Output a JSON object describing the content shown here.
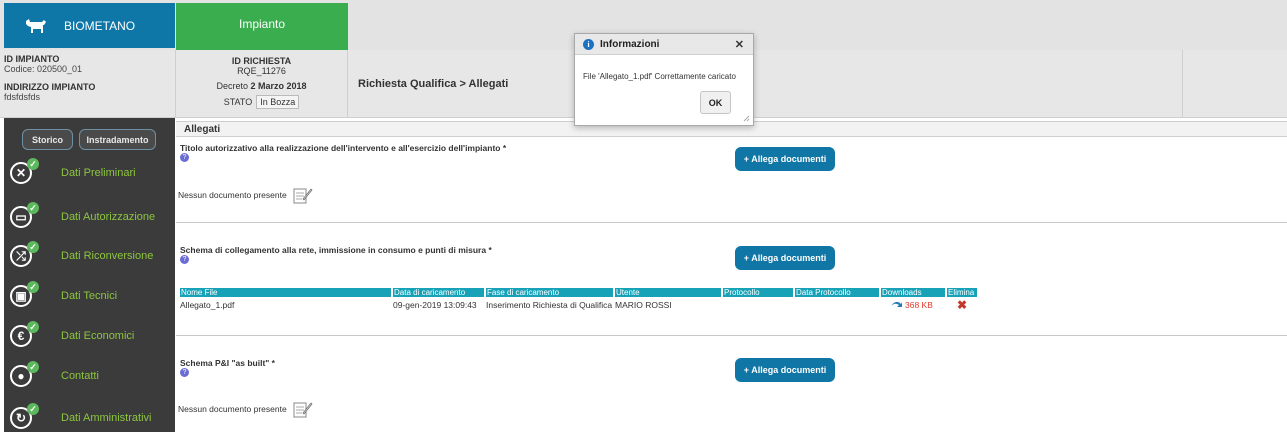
{
  "topbar": {
    "brand_label": "BIOMETANO",
    "brand_icon": "cow-icon",
    "tab_label": "Impianto",
    "colors": {
      "brand": "#0e77a7",
      "tab": "#3aae4f",
      "accent": "#0f76a6",
      "nav_label": "#8cc63f",
      "table_header": "#17a2b8"
    }
  },
  "impianto": {
    "id_label": "ID IMPIANTO",
    "codice": "Codice: 020500_01",
    "indirizzo_label": "INDIRIZZO IMPIANTO",
    "indirizzo_value": "fdsfdsfds"
  },
  "richiesta": {
    "id_label": "ID RICHIESTA",
    "id_value": "RQE_11276",
    "decreto_prefix": "Decreto",
    "decreto_date": "2 Marzo 2018",
    "stato_label": "STATO",
    "stato_value": "In Bozza"
  },
  "breadcrumb": "Richiesta Qualifica > Allegati",
  "sidebar": {
    "storico_label": "Storico",
    "instradamento_label": "Instradamento",
    "items": [
      {
        "label": "Dati Preliminari",
        "icon": "tools-icon",
        "glyph": "✕"
      },
      {
        "label": "Dati Autorizzazione",
        "icon": "calendar-icon",
        "glyph": "▭"
      },
      {
        "label": "Dati Riconversione",
        "icon": "shuffle-icon",
        "glyph": "⤮"
      },
      {
        "label": "Dati Tecnici",
        "icon": "wallet-icon",
        "glyph": "▣"
      },
      {
        "label": "Dati Economici",
        "icon": "euro-icon",
        "glyph": "€"
      },
      {
        "label": "Contatti",
        "icon": "contact-icon",
        "glyph": "●"
      },
      {
        "label": "Dati Amministrativi",
        "icon": "wrench-icon",
        "glyph": "↻"
      }
    ]
  },
  "main": {
    "section_title": "Allegati",
    "allega_label": "+ Allega documenti",
    "help_glyph": "?",
    "no_doc_text": "Nessun documento presente",
    "docs": [
      {
        "title": "Titolo autorizzativo alla realizzazione dell'intervento e all'esercizio dell'impianto *"
      },
      {
        "title": "Schema di collegamento alla rete, immissione in consumo e punti di misura *"
      },
      {
        "title": "Schema P&I \"as built\" *"
      }
    ],
    "file_table": {
      "headers": [
        "Nome File",
        "Data di caricamento",
        "Fase di caricamento",
        "Utente",
        "Protocollo",
        "Data Protocollo",
        "Downloads",
        "Elimina"
      ],
      "rows": [
        {
          "nome": "Allegato_1.pdf",
          "data": "09-gen-2019 13:09:43",
          "fase": "Inserimento Richiesta di Qualifica",
          "utente": "MARIO ROSSI",
          "protocollo": "",
          "data_protocollo": "",
          "downloads": "368 KB",
          "elimina": "✖"
        }
      ]
    }
  },
  "modal": {
    "title": "Informazioni",
    "info_glyph": "i",
    "close_glyph": "✕",
    "message": "File 'Allegato_1.pdf' Correttamente caricato",
    "ok_label": "OK"
  }
}
